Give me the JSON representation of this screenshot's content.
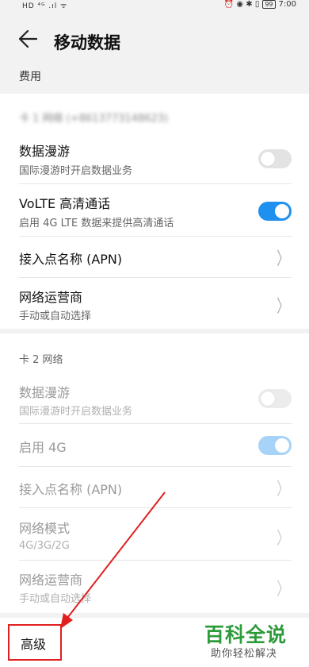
{
  "status_bar": {
    "left_icons": "HD ⁴ᴳ .ıl ᯤ",
    "right_icons": "⏰ ◉ ✱ ▯",
    "battery": "99",
    "time": "7:00"
  },
  "header": {
    "title": "移动数据"
  },
  "fee": {
    "label": "费用"
  },
  "sim1": {
    "header": "卡 1 网络 (+8613773148623)",
    "rows": [
      {
        "title": "数据漫游",
        "subtitle": "国际漫游时开启数据业务",
        "toggle": "off"
      },
      {
        "title": "VoLTE 高清通话",
        "subtitle": "启用 4G LTE 数据来提供高清通话",
        "toggle": "on"
      },
      {
        "title": "接入点名称 (APN)"
      },
      {
        "title": "网络运营商",
        "subtitle": "手动或自动选择"
      }
    ]
  },
  "sim2": {
    "header": "卡 2 网络",
    "rows": [
      {
        "title": "数据漫游",
        "subtitle": "国际漫游时开启数据业务",
        "toggle": "off"
      },
      {
        "title": "启用 4G",
        "toggle": "on"
      },
      {
        "title": "接入点名称 (APN)"
      },
      {
        "title": "网络模式",
        "subtitle": "4G/3G/2G"
      },
      {
        "title": "网络运营商",
        "subtitle": "手动或自动选择"
      }
    ]
  },
  "advanced": {
    "label": "高级"
  },
  "watermark": {
    "title": "百科全说",
    "subtitle": "助你轻松解决"
  },
  "colors": {
    "accent": "#1e90f0",
    "highlight": "#e02020",
    "watermark_green": "#2e9b3a"
  },
  "icons": {
    "back": "arrow-left-icon",
    "chevron": "chevron-right-icon"
  }
}
